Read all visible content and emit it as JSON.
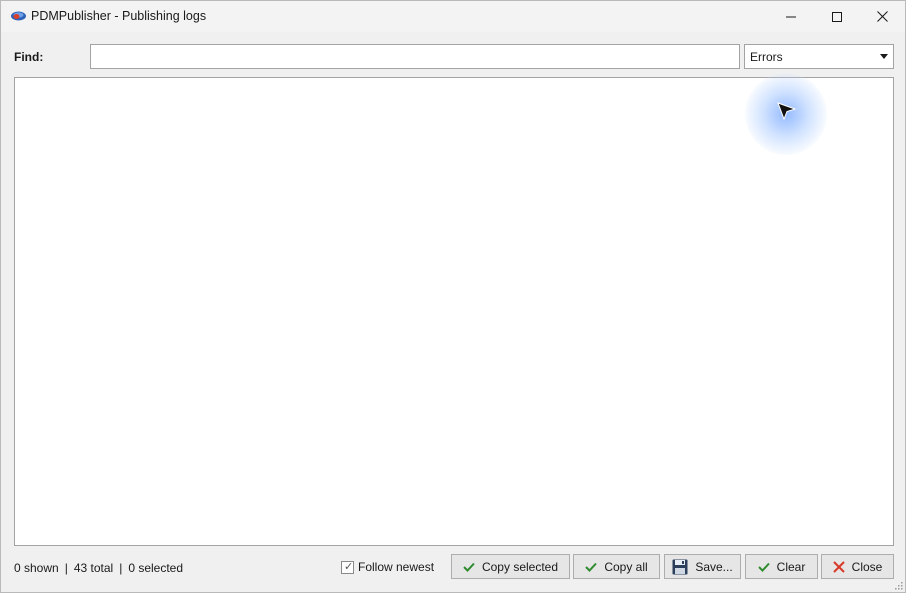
{
  "window": {
    "title": "PDMPublisher - Publishing logs"
  },
  "find": {
    "label": "Find:",
    "value": "",
    "placeholder": ""
  },
  "level_filter": {
    "selected": "Errors"
  },
  "log": {
    "entries": []
  },
  "status": {
    "shown": "0 shown",
    "total": "43 total",
    "selected": "0 selected",
    "separator": "|"
  },
  "follow_newest": {
    "label": "Follow newest",
    "checked": true
  },
  "buttons": {
    "copy_selected": "Copy selected",
    "copy_all": "Copy all",
    "save": "Save...",
    "clear": "Clear",
    "close": "Close"
  },
  "icons": {
    "app": "app-icon",
    "minimize": "minimize-icon",
    "maximize": "maximize-icon",
    "close_window": "close-icon",
    "check": "check-icon",
    "save": "floppy-disk-icon",
    "close_btn": "red-x-icon"
  },
  "colors": {
    "check_green": "#2e8b2e",
    "close_red": "#d83a2a",
    "cursor_highlight": "#82afff"
  }
}
